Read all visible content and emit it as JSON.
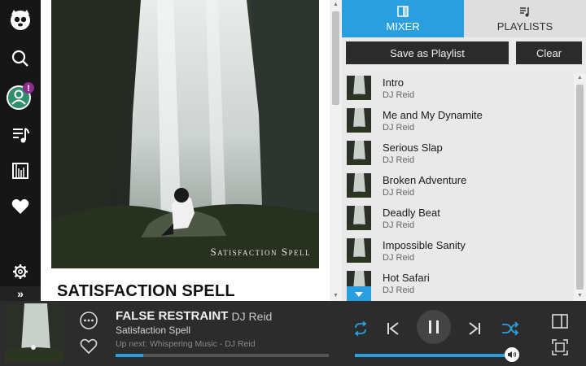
{
  "sidebar": {
    "notification_badge": "!",
    "expand_label": "»"
  },
  "album": {
    "art_caption": "Satisfaction Spell",
    "title": "SATISFACTION SPELL"
  },
  "tabs": [
    {
      "label": "MIXER",
      "icon": "mixer-icon",
      "active": true
    },
    {
      "label": "PLAYLISTS",
      "icon": "playlist-icon",
      "active": false
    }
  ],
  "actions": {
    "save_label": "Save as Playlist",
    "clear_label": "Clear"
  },
  "tracks": [
    {
      "title": "Intro",
      "artist": "DJ Reid"
    },
    {
      "title": "Me and My Dynamite",
      "artist": "DJ Reid"
    },
    {
      "title": "Serious Slap",
      "artist": "DJ Reid"
    },
    {
      "title": "Broken Adventure",
      "artist": "DJ Reid"
    },
    {
      "title": "Deadly Beat",
      "artist": "DJ Reid"
    },
    {
      "title": "Impossible Sanity",
      "artist": "DJ Reid"
    },
    {
      "title": "Hot Safari",
      "artist": "DJ Reid"
    }
  ],
  "player": {
    "title": "FALSE RESTRAINT",
    "artist": "- DJ Reid",
    "album": "Satisfaction Spell",
    "up_next": "Up next: Whispering Music - DJ Reid",
    "progress_fraction": 0.13,
    "volume_fraction": 0.99
  },
  "colors": {
    "accent": "#2a9fdf",
    "sidebar_bg": "#161616",
    "player_bg": "#2c2c2c",
    "badge": "#8e2a8a"
  }
}
